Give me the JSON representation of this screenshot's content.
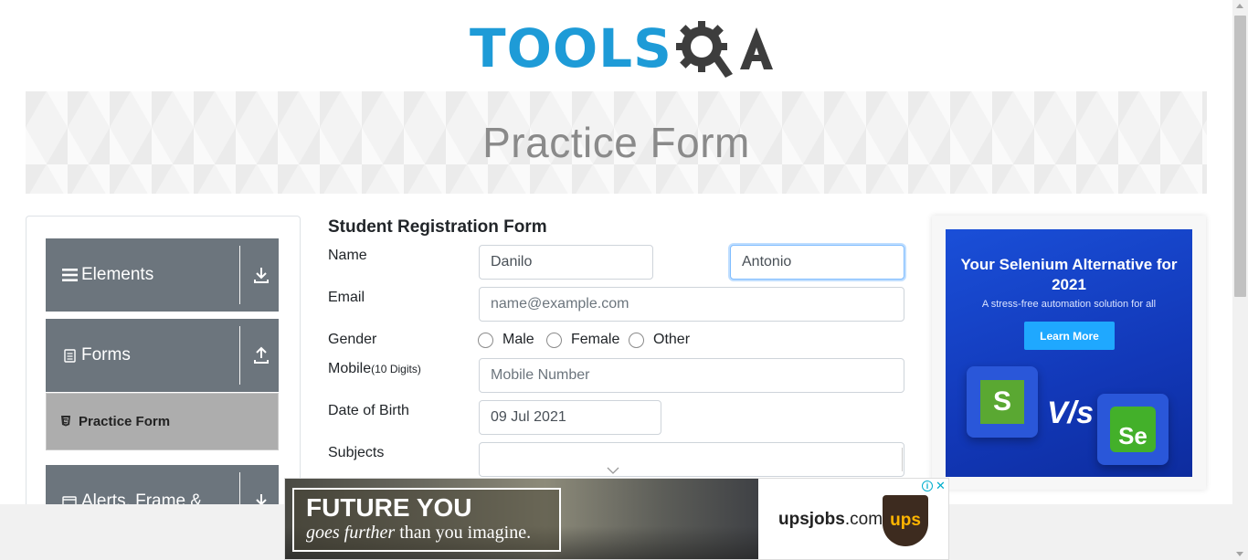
{
  "header": {
    "logo_part1": "TOOLS",
    "logo_part2": "QA"
  },
  "banner": {
    "title": "Practice Form"
  },
  "sidebar": {
    "groups": [
      {
        "label": "Elements",
        "icon": "hamburger-icon",
        "arrow": "download-icon"
      },
      {
        "label": "Forms",
        "icon": "document-icon",
        "arrow": "upload-icon"
      },
      {
        "label": "Alerts, Frame &",
        "icon": "browser-window-icon",
        "arrow": "download-icon"
      }
    ],
    "active_item": {
      "label": "Practice Form",
      "icon": "html5-icon"
    }
  },
  "form": {
    "title": "Student Registration Form",
    "name_label": "Name",
    "first_name_value": "Danilo",
    "last_name_value": "Antonio",
    "email_label": "Email",
    "email_placeholder": "name@example.com",
    "gender_label": "Gender",
    "gender_options": [
      "Male",
      "Female",
      "Other"
    ],
    "mobile_label": "Mobile",
    "mobile_hint": "(10 Digits)",
    "mobile_placeholder": "Mobile Number",
    "dob_label": "Date of Birth",
    "dob_value": "09 Jul 2021",
    "subjects_label": "Subjects",
    "subjects_value": ""
  },
  "right_ad": {
    "headline": "Your Selenium Alternative for 2021",
    "subtext": "A stress-free automation solution for all",
    "button": "Learn More",
    "vs_text": "V/s",
    "left_logo_letter": "S",
    "right_logo_text": "Se"
  },
  "bottom_ad": {
    "headline": "FUTURE YOU",
    "tagline_italic": "goes further",
    "tagline_rest": " than you imagine.",
    "brand_bold": "upsjobs",
    "brand_rest": ".com",
    "brand_logo": "ups",
    "adchoices_icon": "i",
    "close_icon": "✕"
  },
  "colors": {
    "logo_blue": "#1e9bd7",
    "logo_dark": "#3d3d3d",
    "sidebar_group": "#6c757d",
    "sidebar_active": "#adadad",
    "focus_border": "#80bdff",
    "ad_blue": "#1a4fd8"
  }
}
